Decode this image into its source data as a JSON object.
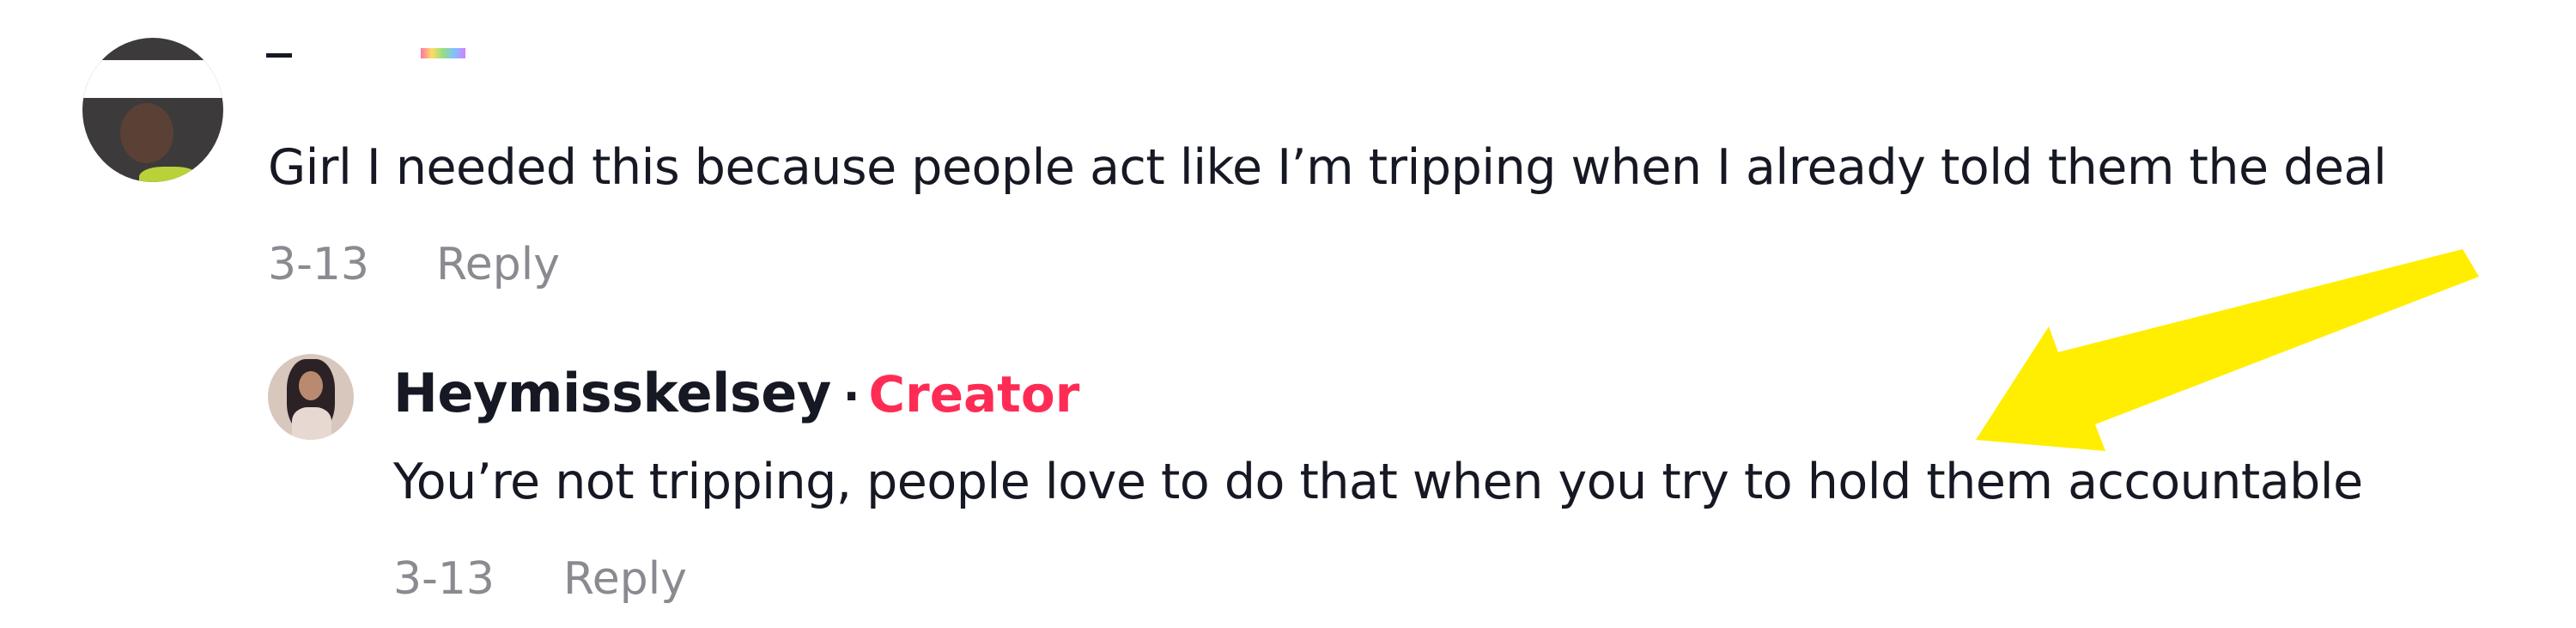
{
  "comment": {
    "author": "",
    "text": "Girl I needed this because people act like I’m tripping when I already told them the deal",
    "date": "3-13",
    "reply_label": "Reply"
  },
  "reply": {
    "author": "Heymisskelsey",
    "separator": "·",
    "badge": "Creator",
    "text": "You’re not tripping, people love to do that when you try to hold them accountable",
    "date": "3-13",
    "reply_label": "Reply"
  },
  "colors": {
    "text": "#161823",
    "meta": "#8a8b91",
    "creator_badge": "#fe2c55",
    "annotation_arrow": "#ffee00"
  },
  "icons": {
    "annotation": "arrow-icon"
  }
}
